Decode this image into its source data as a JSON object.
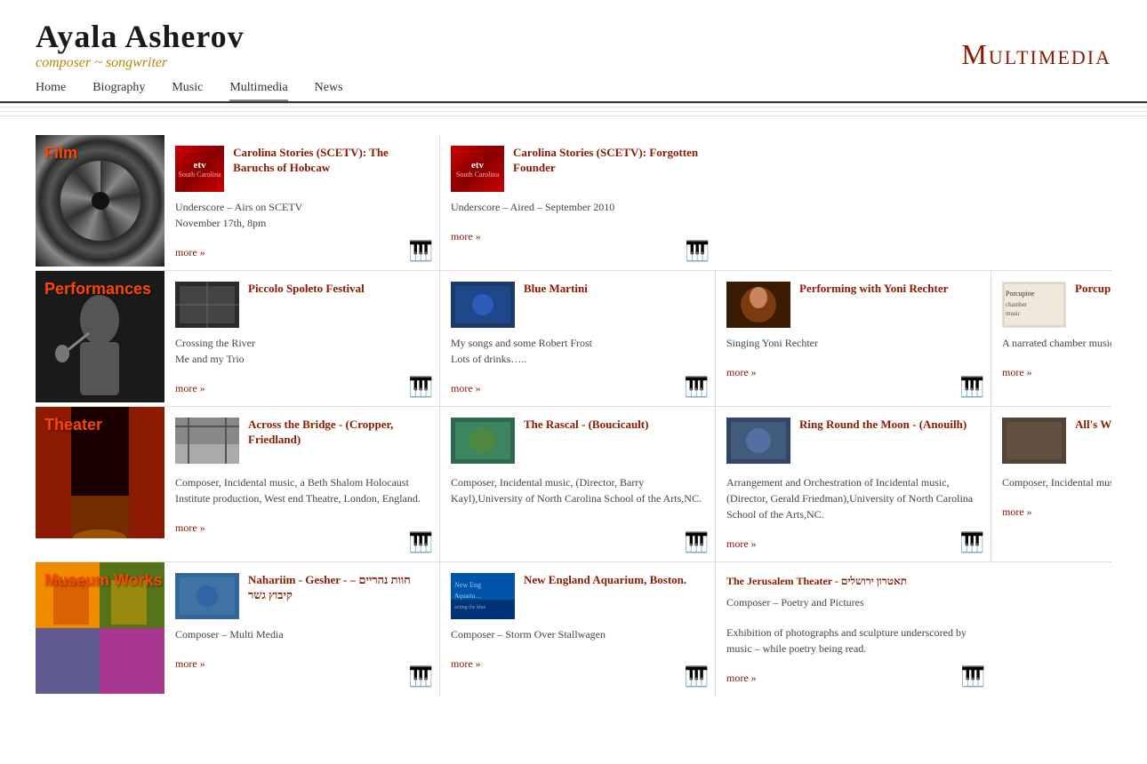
{
  "site": {
    "title": "Ayala Asherov",
    "subtitle": "composer ~ songwriter",
    "page_heading": "Multimedia"
  },
  "nav": {
    "items": [
      "Home",
      "Biography",
      "Music",
      "Multimedia",
      "News"
    ]
  },
  "sections": {
    "film": {
      "label": "Film",
      "cards": [
        {
          "id": "carolina-baruchs",
          "title": "Carolina Stories (SCETV): The Baruchs of Hobcaw",
          "body1": "Underscore – Airs on SCETV",
          "body2": "November 17th, 8pm",
          "more": "more »"
        },
        {
          "id": "carolina-forgotten",
          "title": "Carolina Stories (SCETV): Forgotten Founder",
          "body1": "Underscore – Aired – September 2010",
          "more": "more »"
        }
      ]
    },
    "performances": {
      "label": "Performances",
      "cards": [
        {
          "id": "piccolo-spoleto",
          "title": "Piccolo Spoleto Festival",
          "body1": "Crossing the River",
          "body2": "Me and my Trio",
          "more": "more »"
        },
        {
          "id": "blue-martini",
          "title": "Blue Martini",
          "body1": "My songs and some Robert Frost",
          "body2": "Lots of drinks…..",
          "more": "more »"
        },
        {
          "id": "performing-yoni",
          "title": "Performing with Yoni Rechter",
          "body1": "Singing Yoni Rechter",
          "more": "more »"
        },
        {
          "id": "porcupine-save",
          "title": "Porcupine Save",
          "body1": "A narrated chamber music chamb",
          "more": "more »"
        }
      ]
    },
    "theater": {
      "label": "Theater",
      "cards": [
        {
          "id": "across-bridge",
          "title": "Across the Bridge - (Cropper, Friedland)",
          "body1": "Composer, Incidental music, a Beth Shalom Holocaust Institute production, West end Theatre, London, England.",
          "more": "more »"
        },
        {
          "id": "rascal",
          "title": "The Rascal - (Boucicault)",
          "body1": "Composer, Incidental music, (Director, Barry Kayl),University of North Carolina School of the Arts,NC.",
          "more": ""
        },
        {
          "id": "ring-round",
          "title": "Ring Round the Moon - (Anouilh)",
          "body1": "Arrangement and Orchestration of Incidental music, (Director, Gerald Friedman),University of North Carolina School of the Arts,NC.",
          "more": "more »"
        },
        {
          "id": "alls-well",
          "title": "All's Well That E… Shakespeare)",
          "body1": "Composer, Incidental music.",
          "more": "more »"
        }
      ]
    },
    "museum": {
      "label": "Museum Works",
      "cards": [
        {
          "id": "nahariim",
          "title": "Nahariim - Gesher - חוות נהריים – קיבוץ גשר",
          "body1": "Composer – Multi Media",
          "more": "more »"
        },
        {
          "id": "new-england-aquarium",
          "title": "New England Aquarium, Boston.",
          "body1": "Composer – Storm Over Stallwagen",
          "more": "more »"
        },
        {
          "id": "jerusalem-theater",
          "title": "The Jerusalem Theater - תאטרון ירושלים",
          "body1": "Composer – Poetry and Pictures",
          "body2": "Exhibition of photographs and sculpture underscored by music – while poetry being read.",
          "more": "more »"
        }
      ]
    }
  }
}
